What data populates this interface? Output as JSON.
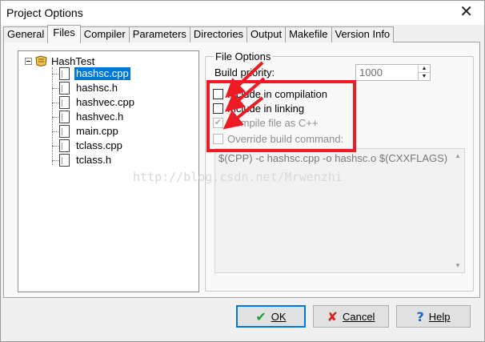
{
  "window": {
    "title": "Project Options",
    "close_icon": "close-icon"
  },
  "tabs": [
    {
      "label": "General"
    },
    {
      "label": "Files",
      "active": true
    },
    {
      "label": "Compiler"
    },
    {
      "label": "Parameters"
    },
    {
      "label": "Directories"
    },
    {
      "label": "Output"
    },
    {
      "label": "Makefile"
    },
    {
      "label": "Version Info"
    }
  ],
  "tree": {
    "root": "HashTest",
    "files": [
      "hashsc.cpp",
      "hashsc.h",
      "hashvec.cpp",
      "hashvec.h",
      "main.cpp",
      "tclass.cpp",
      "tclass.h"
    ],
    "selected": "hashsc.cpp"
  },
  "file_options": {
    "title": "File Options",
    "build_priority_label": "Build priority:",
    "build_priority_value": "1000",
    "checkboxes": [
      {
        "label": "Include in compilation",
        "checked": false,
        "enabled": true
      },
      {
        "label": "Include in linking",
        "checked": false,
        "enabled": true
      },
      {
        "label": "Compile file as C++",
        "checked": true,
        "enabled": false
      },
      {
        "label": "Override build command:",
        "checked": false,
        "enabled": false
      }
    ],
    "build_command": "$(CPP) -c hashsc.cpp -o hashsc.o $(CXXFLAGS)"
  },
  "watermark": "http://blog.csdn.net/Mrwenzhi",
  "buttons": {
    "ok": "OK",
    "cancel": "Cancel",
    "help": "Help"
  },
  "colors": {
    "annotation_red": "#ee1b24",
    "selection_blue": "#0078d7"
  }
}
